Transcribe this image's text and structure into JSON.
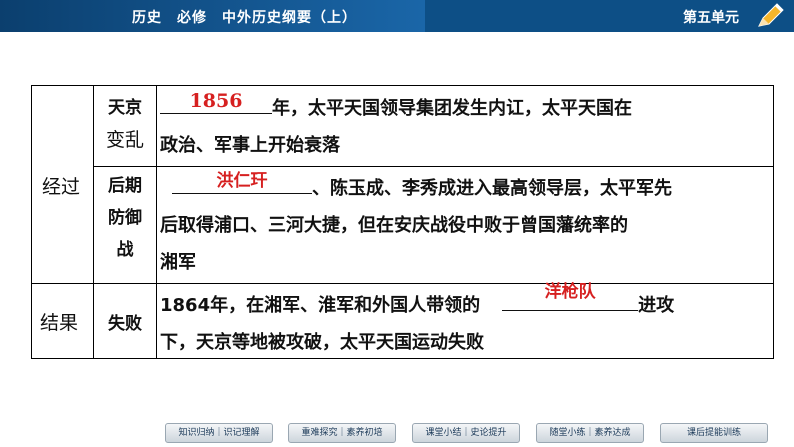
{
  "header": {
    "book_title": "历史　必修　中外历史纲要（上）",
    "unit": "第五单元",
    "pencil_icon": "pencil-icon"
  },
  "table": {
    "col1": {
      "process": "经过",
      "result": "结果"
    },
    "rows": [
      {
        "label_lines": [
          "天京",
          "变乱"
        ],
        "answer": "1856",
        "text_after": "年，太平天国领导集团发生内讧，太平天国在",
        "line2": "政治、军事上开始衰落"
      },
      {
        "label_lines": [
          "后期",
          "防御",
          "战"
        ],
        "answer": "洪仁玕",
        "text_after": "、陈玉成、李秀成进入最高领导层，太平军先",
        "line2": "后取得浦口、三河大捷，但在安庆战役中败于曾国藩统率的",
        "line3": "湘军"
      },
      {
        "label_lines": [
          "失败"
        ],
        "text_before": "1864年，在湘军、淮军和外国人带领的",
        "answer": "洋枪队",
        "text_after": "进攻",
        "line2": "下，天京等地被攻破，太平天国运动失败"
      }
    ]
  },
  "footer": {
    "buttons": [
      "知识归纳｜识记理解",
      "重难探究｜素养初培",
      "课堂小结｜史论提升",
      "随堂小练｜素养达成",
      "课后提能训练"
    ]
  }
}
